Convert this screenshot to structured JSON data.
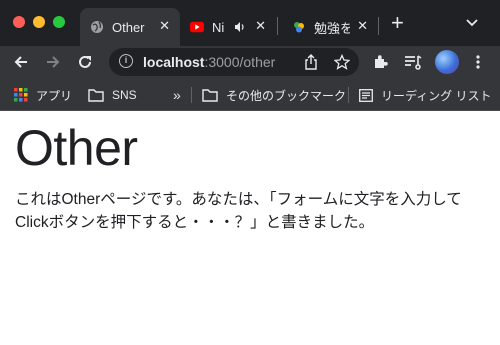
{
  "tabs": [
    {
      "title": "Other",
      "active": true
    },
    {
      "title": "Ni"
    },
    {
      "title": "勉強を"
    }
  ],
  "address": {
    "host": "localhost",
    "path": ":3000/other"
  },
  "bookmarks": {
    "apps": "アプリ",
    "sns": "SNS",
    "more": "»",
    "other": "その他のブックマーク",
    "reading": "リーディング リスト"
  },
  "page": {
    "heading": "Other",
    "paragraph": "これはOtherページです。あなたは、「フォームに文字を入力してClickボタンを押下すると・・・？」と書きました。"
  },
  "colors": {
    "chrome": "#202124",
    "toolbar": "#35363a",
    "youtube": "#ff0000"
  }
}
